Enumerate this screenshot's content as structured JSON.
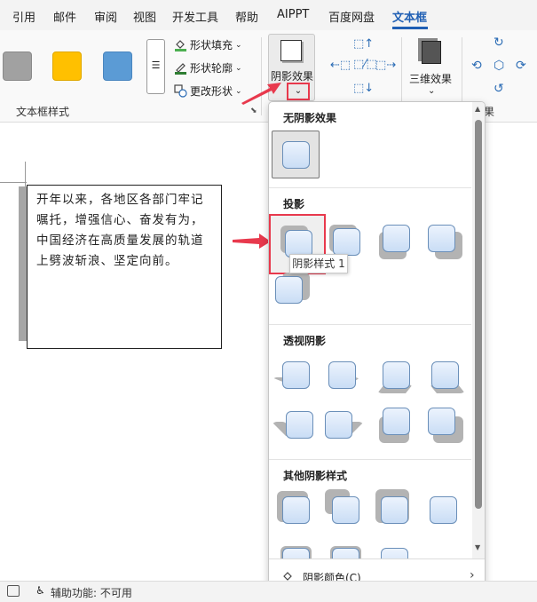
{
  "menu": {
    "tabs": [
      "引用",
      "邮件",
      "审阅",
      "视图",
      "开发工具",
      "帮助",
      "AIPPT",
      "百度网盘",
      "文本框"
    ],
    "active": "文本框"
  },
  "ribbon": {
    "style_group_label": "文本框样式",
    "shape_fill": "形状填充",
    "shape_outline": "形状轮廓",
    "change_shape": "更改形状",
    "shadow_effects": "阴影效果",
    "three_d_effects": "三维效果",
    "cut_label": "果",
    "swatch_colors": [
      "#a1a1a1",
      "#ffc000",
      "#5b9bd5"
    ]
  },
  "document": {
    "text": "开年以来，各地区各部门牢记嘱托，增强信心、奋发有为，中国经济在高质量发展的轨道上劈波斩浪、坚定向前。"
  },
  "dropdown": {
    "no_shadow": "无阴影效果",
    "drop_shadow": "投影",
    "perspective": "透视阴影",
    "other": "其他阴影样式",
    "tooltip": "阴影样式 1",
    "shadow_color": "阴影颜色(C)"
  },
  "status": {
    "accessibility": "辅助功能: 不可用"
  },
  "colors": {
    "accent": "#1f5fb4",
    "highlight": "#e8394d"
  }
}
